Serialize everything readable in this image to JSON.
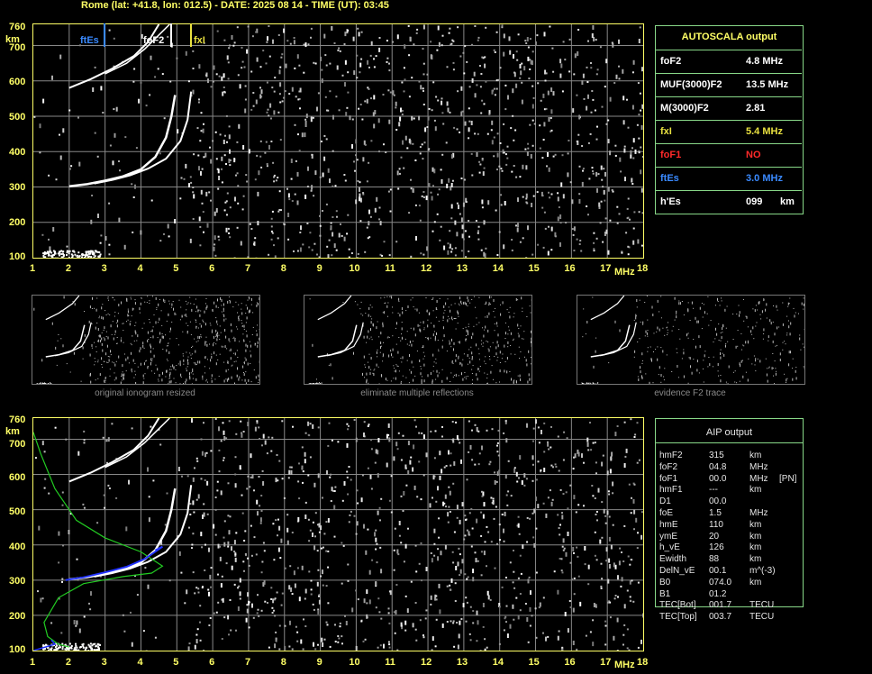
{
  "header": {
    "title": "Rome (lat: +41.8, lon: 012.5) - DATE: 2025 08 14 - TIME (UT): 03:45"
  },
  "axes": {
    "y_unit": "km",
    "x_unit": "MHz",
    "y_ticks": [
      "760",
      "700",
      "600",
      "500",
      "400",
      "300",
      "200",
      "100"
    ],
    "x_ticks": [
      "1",
      "2",
      "3",
      "4",
      "5",
      "6",
      "7",
      "8",
      "9",
      "10",
      "11",
      "12",
      "13",
      "14",
      "15",
      "16",
      "17",
      "18"
    ]
  },
  "markers": {
    "ftEs": "ftEs",
    "foF2": "foF2",
    "fxI": "fxI"
  },
  "autoscala": {
    "title": "AUTOSCALA output",
    "rows": [
      {
        "label": "foF2",
        "value": "4.8 MHz",
        "color": "#ffffff"
      },
      {
        "label": "MUF(3000)F2",
        "value": "13.5 MHz",
        "color": "#ffffff"
      },
      {
        "label": "M(3000)F2",
        "value": "2.81",
        "color": "#ffffff"
      },
      {
        "label": "fxI",
        "value": "5.4 MHz",
        "color": "#e8e040"
      },
      {
        "label": "foF1",
        "value": "NO",
        "color": "#ff2a2a"
      },
      {
        "label": "ftEs",
        "value": "3.0 MHz",
        "color": "#3a8aff"
      },
      {
        "label": "h'Es",
        "value": "099",
        "unit": "km",
        "color": "#ffffff"
      }
    ]
  },
  "thumbnails": [
    {
      "caption": "original ionogram resized"
    },
    {
      "caption": "eliminate multiple reflections"
    },
    {
      "caption": "evidence F2 trace"
    }
  ],
  "aip": {
    "title": "AIP output",
    "rows": [
      {
        "label": "hmF2",
        "value": "315",
        "unit": "km",
        "extra": ""
      },
      {
        "label": "foF2",
        "value": "04.8",
        "unit": "MHz",
        "extra": ""
      },
      {
        "label": "foF1",
        "value": "00.0",
        "unit": "MHz",
        "extra": "[PN]"
      },
      {
        "label": "hmF1",
        "value": "---",
        "unit": "km",
        "extra": ""
      },
      {
        "label": "D1",
        "value": "00.0",
        "unit": "",
        "extra": ""
      },
      {
        "label": "foE",
        "value": "1.5",
        "unit": "MHz",
        "extra": ""
      },
      {
        "label": "hmE",
        "value": "110",
        "unit": "km",
        "extra": ""
      },
      {
        "label": "ymE",
        "value": "20",
        "unit": "km",
        "extra": ""
      },
      {
        "label": "h_vE",
        "value": "126",
        "unit": "km",
        "extra": ""
      },
      {
        "label": "Ewidth",
        "value": "88",
        "unit": "km",
        "extra": ""
      },
      {
        "label": "DelN_vE",
        "value": "00.1",
        "unit": "m^(-3)",
        "extra": ""
      },
      {
        "label": "B0",
        "value": "074.0",
        "unit": "km",
        "extra": ""
      },
      {
        "label": "B1",
        "value": "01.2",
        "unit": "",
        "extra": ""
      },
      {
        "label": "TEC[Bot]",
        "value": "001.7",
        "unit": "TECU",
        "extra": ""
      },
      {
        "label": "TEC[Top]",
        "value": "003.7",
        "unit": "TECU",
        "extra": ""
      }
    ]
  },
  "colors": {
    "axis": "#ffff66",
    "grid": "#888888",
    "panel_border": "#88d888",
    "ftEs_marker": "#3a8aff",
    "foF2_marker": "#ffffff",
    "fxI_marker": "#e8e040",
    "profile_green": "#22cc22",
    "profile_blue": "#2233ff"
  }
}
